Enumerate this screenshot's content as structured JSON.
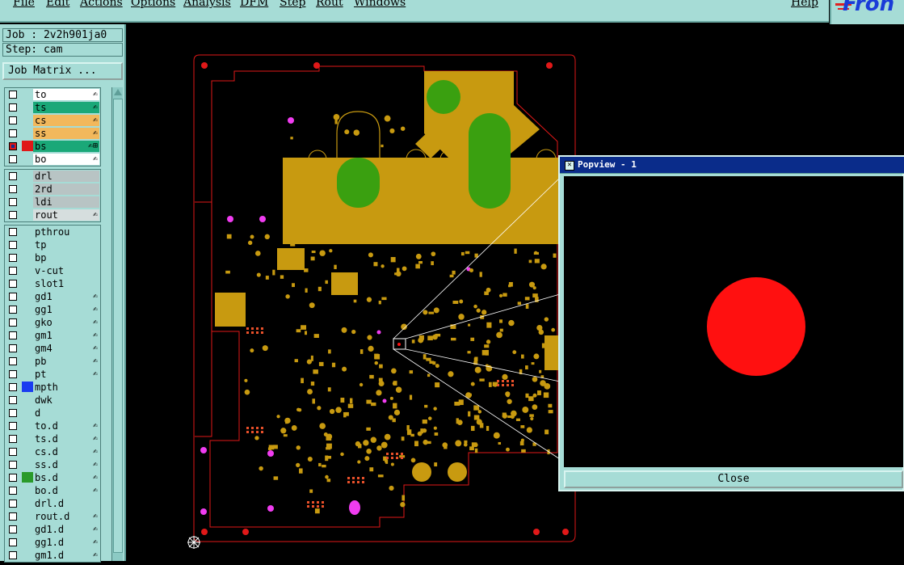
{
  "menubar": {
    "items": [
      "File",
      "Edit",
      "Actions",
      "Options",
      "Analysis",
      "DFM",
      "Step",
      "Rout",
      "Windows"
    ],
    "help": "Help"
  },
  "brand": {
    "logo": "Fron"
  },
  "job": {
    "label": "Job : 2v2h901ja0"
  },
  "step": {
    "label": "Step: cam"
  },
  "job_matrix_button": "Job Matrix ...",
  "layer_groups": [
    [
      {
        "name": "to",
        "color": "#ffffff",
        "tag": "✍"
      },
      {
        "name": "ts",
        "color": "#1aa878",
        "tag": "✍"
      },
      {
        "name": "cs",
        "color": "#f2b85c",
        "tag": "✍"
      },
      {
        "name": "ss",
        "color": "#f2b85c",
        "tag": "✍"
      },
      {
        "name": "bs",
        "color": "#1aa878",
        "tag": "✍⊞",
        "selected": true,
        "swatch": "#e01818"
      },
      {
        "name": "bo",
        "color": "#ffffff",
        "tag": "✍"
      }
    ],
    [
      {
        "name": "drl",
        "color": "#b8c4c4",
        "tag": ""
      },
      {
        "name": "2rd",
        "color": "#b8c4c4",
        "tag": ""
      },
      {
        "name": "ldi",
        "color": "#b8c4c4",
        "tag": ""
      },
      {
        "name": "rout",
        "color": "#d6dede",
        "tag": "✍"
      }
    ],
    [
      {
        "name": "pthrou",
        "tag": ""
      },
      {
        "name": "tp",
        "tag": ""
      },
      {
        "name": "bp",
        "tag": ""
      },
      {
        "name": "v-cut",
        "tag": ""
      },
      {
        "name": "slot1",
        "tag": ""
      },
      {
        "name": "gd1",
        "tag": "✍"
      },
      {
        "name": "gg1",
        "tag": "✍"
      },
      {
        "name": "gko",
        "tag": "✍"
      },
      {
        "name": "gm1",
        "tag": "✍"
      },
      {
        "name": "gm4",
        "tag": "✍"
      },
      {
        "name": "pb",
        "tag": "✍"
      },
      {
        "name": "pt",
        "tag": "✍"
      },
      {
        "name": "mpth",
        "tag": "",
        "swatch": "#1a3cf0"
      },
      {
        "name": "dwk",
        "tag": ""
      },
      {
        "name": "d",
        "tag": ""
      },
      {
        "name": "to.d",
        "tag": "✍"
      },
      {
        "name": "ts.d",
        "tag": "✍"
      },
      {
        "name": "cs.d",
        "tag": "✍"
      },
      {
        "name": "ss.d",
        "tag": "✍"
      },
      {
        "name": "bs.d",
        "tag": "✍",
        "swatch": "#2a9a2a"
      },
      {
        "name": "bo.d",
        "tag": "✍"
      },
      {
        "name": "drl.d",
        "tag": ""
      },
      {
        "name": "rout.d",
        "tag": "✍"
      },
      {
        "name": "gd1.d",
        "tag": "✍"
      },
      {
        "name": "gg1.d",
        "tag": "✍"
      },
      {
        "name": "gm1.d",
        "tag": "✍"
      }
    ]
  ],
  "popview": {
    "title": "Popview - 1",
    "close_label": "Close"
  },
  "colors": {
    "board_outline": "#e01818",
    "copper": "#c89a10",
    "mask": "#3aa010",
    "magenta_pad": "#f03cf0",
    "zoom_dot": "#ff1010"
  }
}
